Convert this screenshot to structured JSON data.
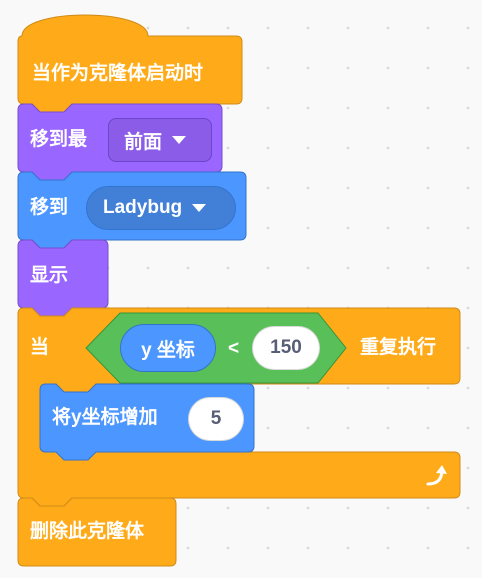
{
  "hat": {
    "label": "当作为克隆体启动时"
  },
  "go_to_front": {
    "label": "移到最",
    "dropdown_value": "前面"
  },
  "go_to": {
    "label": "移到",
    "dropdown_value": "Ladybug"
  },
  "show": {
    "label": "显示"
  },
  "repeat_until": {
    "prefix": "当",
    "suffix": "重复执行",
    "condition": {
      "reporter": "y 坐标",
      "operator": "<",
      "value": "150"
    },
    "loop_icon": "loop-arrow-icon"
  },
  "change_y": {
    "label": "将y坐标增加",
    "value": "5"
  },
  "delete_clone": {
    "label": "删除此克隆体"
  },
  "colors": {
    "events": "#ffab19",
    "events_stroke": "#cf8b17",
    "looks": "#9966ff",
    "looks_stroke": "#774dcb",
    "motion": "#4c97ff",
    "motion_stroke": "#3373cc",
    "operators": "#59c059",
    "operators_stroke": "#389438"
  }
}
